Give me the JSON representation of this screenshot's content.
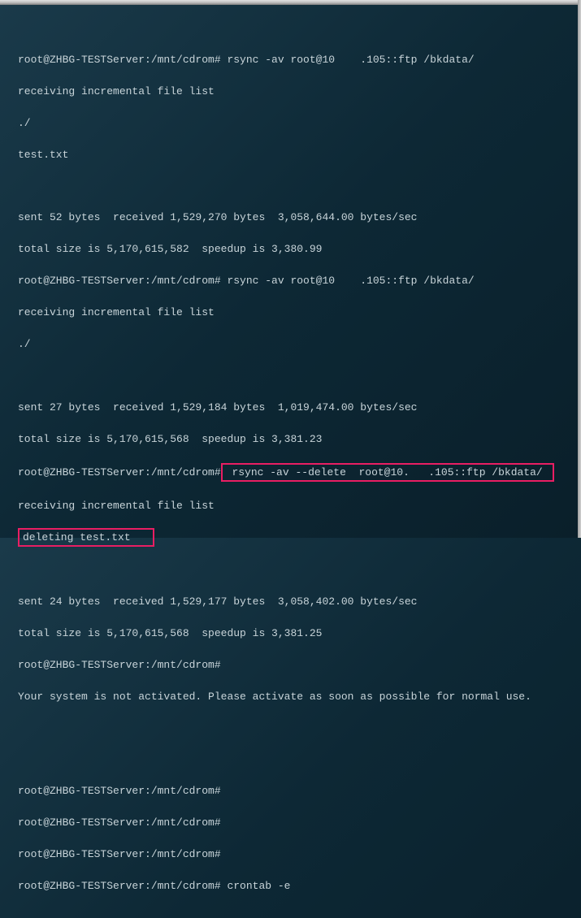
{
  "lines": {
    "l1": "root@ZHBG-TESTServer:/mnt/cdrom# rsync -av root@10    .105::ftp /bkdata/",
    "l2": "receiving incremental file list",
    "l3": "./",
    "l4": "test.txt",
    "l5": "",
    "l6": "sent 52 bytes  received 1,529,270 bytes  3,058,644.00 bytes/sec",
    "l7": "total size is 5,170,615,582  speedup is 3,380.99",
    "l8": "root@ZHBG-TESTServer:/mnt/cdrom# rsync -av root@10    .105::ftp /bkdata/",
    "l9": "receiving incremental file list",
    "l10": "./",
    "l11": "",
    "l12": "sent 27 bytes  received 1,529,184 bytes  1,019,474.00 bytes/sec",
    "l13": "total size is 5,170,615,568  speedup is 3,381.23",
    "l14a": "root@ZHBG-TESTServer:/mnt/cdrom#",
    "l14b": " rsync -av --delete  root@10.   .105::ftp /bkdata/ ",
    "l15": "receiving incremental file list",
    "l16": "deleting test.txt   ",
    "l17": "",
    "l18": "sent 24 bytes  received 1,529,177 bytes  3,058,402.00 bytes/sec",
    "l19": "total size is 5,170,615,568  speedup is 3,381.25",
    "l20": "root@ZHBG-TESTServer:/mnt/cdrom#",
    "l21": "Your system is not activated. Please activate as soon as possible for normal use.",
    "l22": "",
    "l23": "",
    "l24": "root@ZHBG-TESTServer:/mnt/cdrom#",
    "l25": "root@ZHBG-TESTServer:/mnt/cdrom#",
    "l26": "root@ZHBG-TESTServer:/mnt/cdrom#",
    "l27": "root@ZHBG-TESTServer:/mnt/cdrom# crontab -e"
  }
}
